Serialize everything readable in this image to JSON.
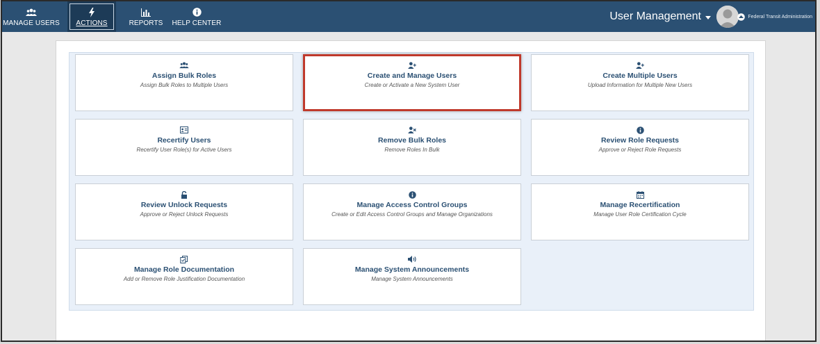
{
  "colors": {
    "nav_bg": "#2b5073",
    "nav_active_bg": "#1d3b57",
    "title_text": "#2b5073",
    "highlight_border": "#c0392b",
    "grid_bg": "#e9f0f9"
  },
  "nav": {
    "items": [
      {
        "label": "MANAGE USERS",
        "icon": "users-icon"
      },
      {
        "label": "ACTIONS",
        "icon": "bolt-icon",
        "active": true
      },
      {
        "label": "REPORTS",
        "icon": "bar-chart-icon"
      },
      {
        "label": "HELP CENTER",
        "icon": "info-icon"
      }
    ]
  },
  "header": {
    "user_menu_label": "User Management",
    "agency_name": "Federal Transit Administration"
  },
  "cards": [
    {
      "title": "Assign Bulk Roles",
      "desc": "Assign Bulk Roles to Multiple Users",
      "icon": "users-icon"
    },
    {
      "title": "Create and Manage Users",
      "desc": "Create or Activate a New System User",
      "icon": "user-plus-icon",
      "highlighted": true
    },
    {
      "title": "Create Multiple Users",
      "desc": "Upload Information for Multiple New Users",
      "icon": "user-plus-icon"
    },
    {
      "title": "Recertify Users",
      "desc": "Recertify User Role(s) for Active Users",
      "icon": "id-card-icon"
    },
    {
      "title": "Remove Bulk Roles",
      "desc": "Remove Roles In Bulk",
      "icon": "user-remove-icon"
    },
    {
      "title": "Review Role Requests",
      "desc": "Approve or Reject Role Requests",
      "icon": "info-circle-icon"
    },
    {
      "title": "Review Unlock Requests",
      "desc": "Approve or Reject Unlock Requests",
      "icon": "unlock-icon"
    },
    {
      "title": "Manage Access Control Groups",
      "desc": "Create or Edit Access Control Groups and Manage Organizations",
      "icon": "info-circle-icon"
    },
    {
      "title": "Manage Recertification",
      "desc": "Manage User Role Certification Cycle",
      "icon": "calendar-icon"
    },
    {
      "title": "Manage Role Documentation",
      "desc": "Add or Remove Role Justification Documentation",
      "icon": "documents-icon"
    },
    {
      "title": "Manage System Announcements",
      "desc": "Manage System Announcements",
      "icon": "volume-icon"
    }
  ]
}
